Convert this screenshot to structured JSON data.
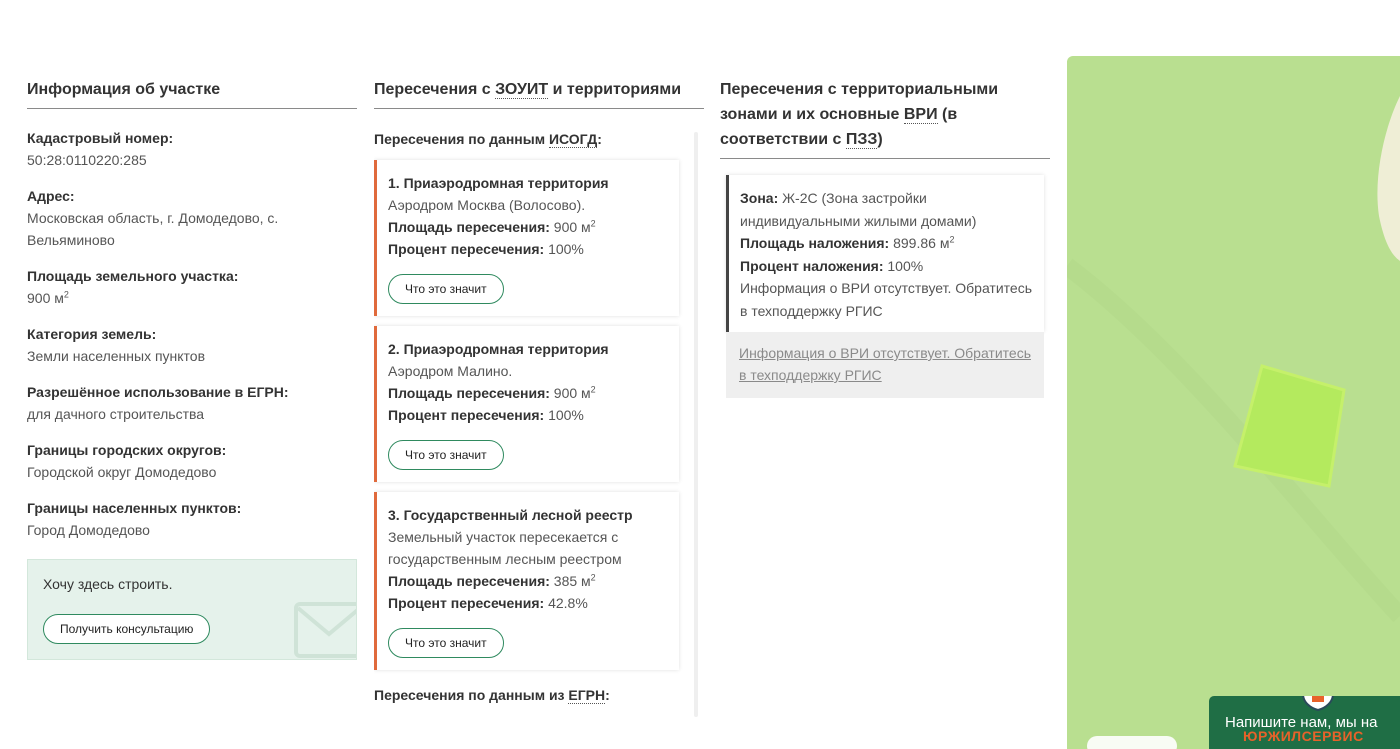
{
  "plot_info": {
    "title": "Информация об участке",
    "fields": [
      {
        "label": "Кадастровый номер:",
        "value": "50:28:0110220:285"
      },
      {
        "label": "Адрес:",
        "value": "Московская область, г. Домодедово, с. Вельяминово"
      },
      {
        "label": "Площадь земельного участка:",
        "value": "900 м",
        "sup": "2"
      },
      {
        "label": "Категория земель:",
        "value": "Земли населенных пунктов"
      },
      {
        "label": "Разрешённое использование в ЕГРН:",
        "value": "для дачного строительства"
      },
      {
        "label": "Границы городских округов:",
        "value": "Городской округ Домодедово"
      },
      {
        "label": "Границы населенных пунктов:",
        "value": "Город Домодедово"
      }
    ],
    "consult": {
      "text": "Хочу здесь строить.",
      "button": "Получить консультацию"
    }
  },
  "intersections": {
    "title_prefix": "Пересечения с ",
    "title_abbr": "ЗОУИТ",
    "title_suffix": " и территориями",
    "isogd_prefix": "Пересечения по данным ",
    "isogd_abbr": "ИСОГД",
    "isogd_suffix": ":",
    "area_label": "Площадь пересечения:",
    "percent_label": "Процент пересечения:",
    "button_label": "Что это значит",
    "items": [
      {
        "title": "1. Приаэродромная территория",
        "desc": "Аэродром Москва (Волосово).",
        "area": "900 м",
        "sup": "2",
        "percent": "100%"
      },
      {
        "title": "2. Приаэродромная территория",
        "desc": "Аэродром Малино.",
        "area": "900 м",
        "sup": "2",
        "percent": "100%"
      },
      {
        "title": "3. Государственный лесной реестр",
        "desc": "Земельный участок пересекается с государственным лесным реестром",
        "area": "385 м",
        "sup": "2",
        "percent": "42.8%"
      }
    ],
    "egrn_prefix": "Пересечения по данным из ",
    "egrn_abbr": "ЕГРН",
    "egrn_suffix": ":"
  },
  "zones": {
    "title_line1": "Пересечения с территориальными зонами и их основные ",
    "title_abbr1": "ВРИ",
    "title_mid": " (в соответствии с ",
    "title_abbr2": "ПЗЗ",
    "title_end": ")",
    "zone_label": "Зона:",
    "zone_value": "Ж-2С (Зона застройки индивидуальными жилыми домами)",
    "area_label": "Площадь наложения:",
    "area_value": "899.86 м",
    "area_sup": "2",
    "percent_label": "Процент наложения:",
    "percent_value": "100%",
    "note": "Информация о ВРИ отсутствует. Обратитесь в техподдержку РГИС",
    "link": "Информация о ВРИ отсутствует. Обратитесь в техподдержку РГИС"
  },
  "map": {
    "background": "#b9df90",
    "parcel_color": "#b4ea5e"
  },
  "chat": {
    "text": "Напишите нам, мы на",
    "brand": "ЮРЖИЛСЕРВИС"
  }
}
